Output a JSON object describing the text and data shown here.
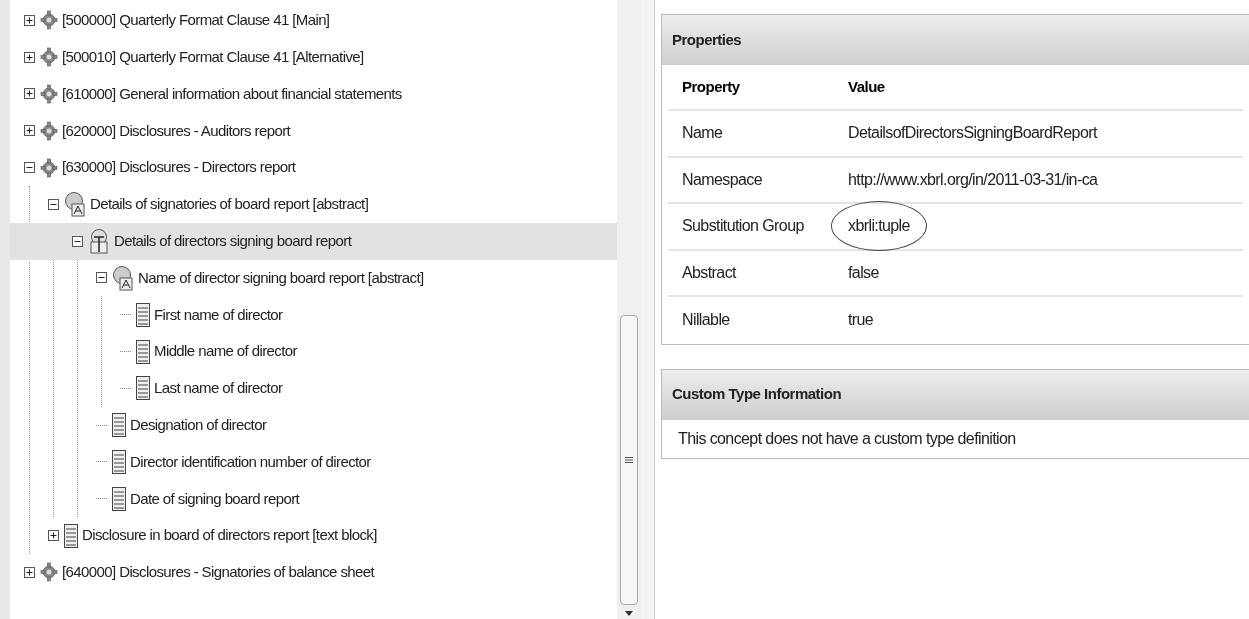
{
  "tree": [
    {
      "kind": "network",
      "label": "[500000] Quarterly Format Clause 41 [Main]",
      "expanded": false,
      "selected": false
    },
    {
      "kind": "network",
      "label": "[500010] Quarterly Format Clause 41 [Alternative]",
      "expanded": false,
      "selected": false
    },
    {
      "kind": "network",
      "label": "[610000] General information about financial statements",
      "expanded": false,
      "selected": false
    },
    {
      "kind": "network",
      "label": "[620000] Disclosures - Auditors report",
      "expanded": false,
      "selected": false
    },
    {
      "kind": "network",
      "label": "[630000] Disclosures - Directors report",
      "expanded": true,
      "selected": false,
      "children": [
        {
          "kind": "abstract",
          "label": "Details of signatories of board report [abstract]",
          "expanded": true,
          "selected": false,
          "children": [
            {
              "kind": "tuple",
              "label": "Details of directors signing board report",
              "expanded": true,
              "selected": true,
              "children": [
                {
                  "kind": "abstract",
                  "label": "Name of director signing board report [abstract]",
                  "expanded": true,
                  "selected": false,
                  "children": [
                    {
                      "kind": "item",
                      "label": "First name of director",
                      "selected": false
                    },
                    {
                      "kind": "item",
                      "label": "Middle name of director",
                      "selected": false
                    },
                    {
                      "kind": "item",
                      "label": "Last name of director",
                      "selected": false
                    }
                  ]
                },
                {
                  "kind": "item",
                  "label": "Designation of director",
                  "selected": false
                },
                {
                  "kind": "item",
                  "label": "Director identification number of director",
                  "selected": false
                },
                {
                  "kind": "item",
                  "label": "Date of signing board report",
                  "selected": false
                }
              ]
            }
          ]
        },
        {
          "kind": "item",
          "label": "Disclosure in board of directors report [text block]",
          "expanded": false,
          "selected": false
        }
      ]
    },
    {
      "kind": "network",
      "label": "[640000] Disclosures - Signatories of balance sheet",
      "expanded": false,
      "selected": false
    }
  ],
  "properties": {
    "title": "Properties",
    "columns": [
      "Property",
      "Value"
    ],
    "rows": [
      {
        "property": "Name",
        "value": "DetailsofDirectorsSigningBoardReport",
        "circled": false
      },
      {
        "property": "Namespace",
        "value": "http://www.xbrl.org/in/2011-03-31/in-ca",
        "circled": false
      },
      {
        "property": "Substitution Group",
        "value": "xbrli:tuple",
        "circled": true
      },
      {
        "property": "Abstract",
        "value": "false",
        "circled": false
      },
      {
        "property": "Nillable",
        "value": "true",
        "circled": false
      }
    ]
  },
  "custom_type": {
    "title": "Custom Type Information",
    "text": "This concept does not have a custom type definition"
  }
}
